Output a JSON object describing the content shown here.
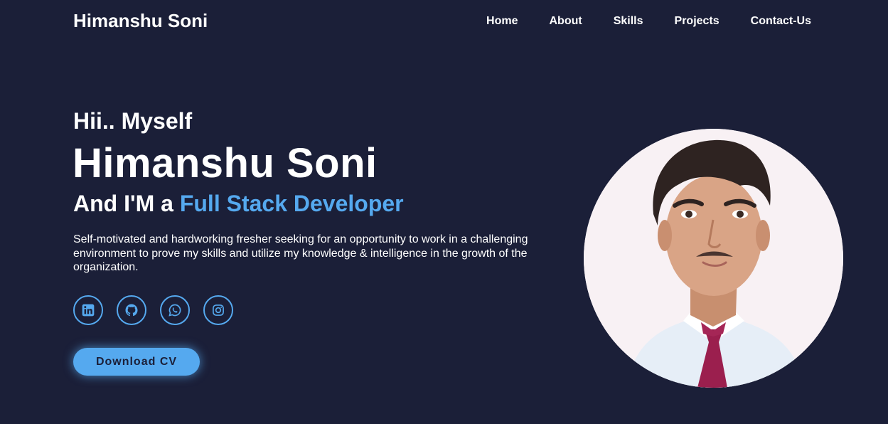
{
  "header": {
    "logo": "Himanshu Soni",
    "nav": [
      "Home",
      "About",
      "Skills",
      "Projects",
      "Contact-Us"
    ]
  },
  "hero": {
    "greeting": "Hii.. Myself",
    "name": "Himanshu Soni",
    "role_prefix": "And I'M a ",
    "role_highlight": "Full Stack Developer",
    "description": "Self-motivated and hardworking fresher seeking for an opportunity to work in a challenging environment to prove my skills and utilize my knowledge & intelligence in the growth of the organization.",
    "socials": [
      "linkedin-icon",
      "github-icon",
      "whatsapp-icon",
      "instagram-icon"
    ],
    "cta_label": "Download CV"
  },
  "colors": {
    "background": "#1b1f38",
    "accent": "#55a9ef",
    "text": "#ffffff"
  }
}
